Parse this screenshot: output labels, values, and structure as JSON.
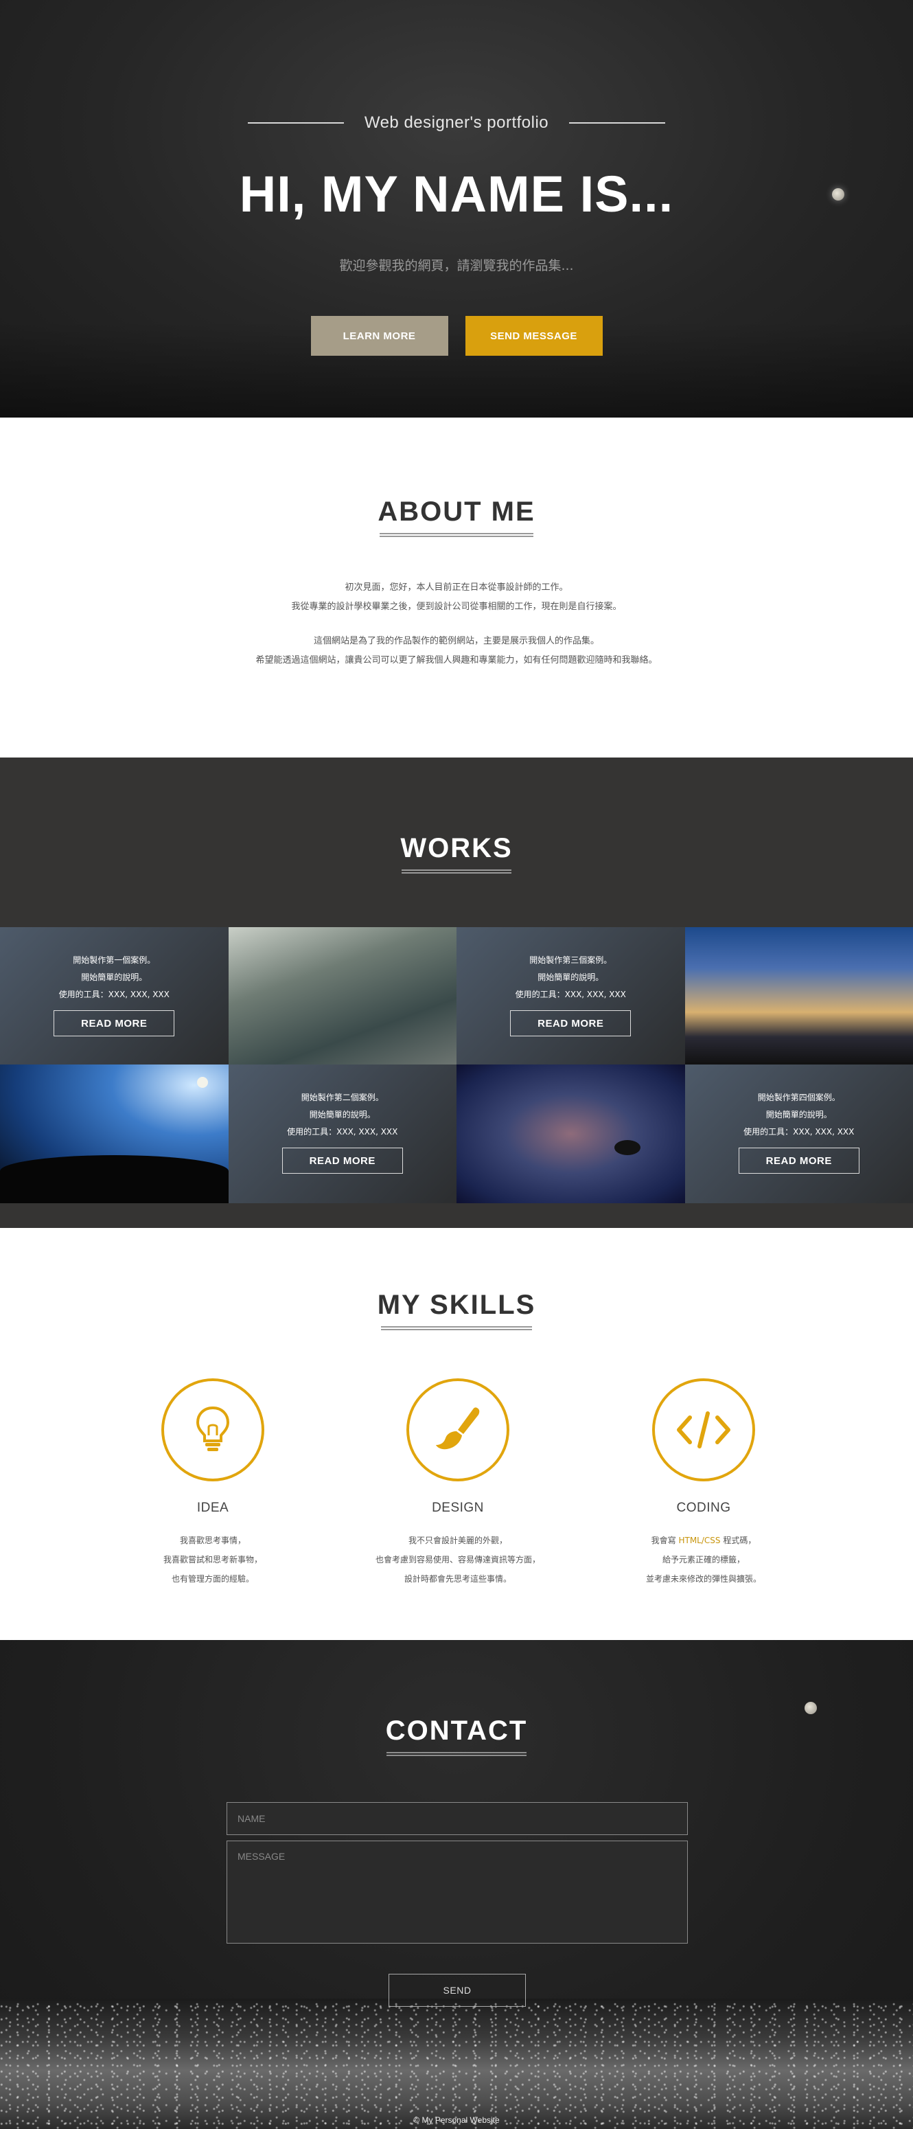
{
  "hero": {
    "subtitle": "Web designer's portfolio",
    "title": "HI, MY NAME IS...",
    "description": "歡迎參觀我的網頁，請瀏覽我的作品集...",
    "learn_more": "LEARN MORE",
    "send_message": "SEND MESSAGE",
    "colors": {
      "learn_more_bg": "#a69d88",
      "send_message_bg": "#d9a00e"
    }
  },
  "about": {
    "title": "ABOUT ME",
    "paragraph1": [
      "初次見面，您好，本人目前正在日本從事設計師的工作。",
      "我從專業的設計學校畢業之後，便到設計公司從事相關的工作，現在則是自行接案。"
    ],
    "paragraph2": [
      "這個網站是為了我的作品製作的範例網站，主要是展示我個人的作品集。",
      "希望能透過這個網站，讓貴公司可以更了解我個人興趣和專業能力，如有任何問題歡迎隨時和我聯絡。"
    ]
  },
  "works": {
    "title": "WORKS",
    "items": [
      {
        "lines": [
          "開始製作第一個案例。",
          "開始簡單的說明。",
          "使用的工具：XXX, XXX, XXX"
        ],
        "button": "READ MORE"
      },
      {
        "lines": [
          "開始製作第二個案例。",
          "開始簡單的說明。",
          "使用的工具：XXX, XXX, XXX"
        ],
        "button": "READ MORE"
      },
      {
        "lines": [
          "開始製作第三個案例。",
          "開始簡單的說明。",
          "使用的工具：XXX, XXX, XXX"
        ],
        "button": "READ MORE"
      },
      {
        "lines": [
          "開始製作第四個案例。",
          "開始簡單的說明。",
          "使用的工具：XXX, XXX, XXX"
        ],
        "button": "READ MORE"
      }
    ]
  },
  "skills": {
    "title": "MY SKILLS",
    "accent": "#e1a50d",
    "items": [
      {
        "icon": "lightbulb-icon",
        "name": "IDEA",
        "lines": [
          "我喜歡思考事情，",
          "我喜歡嘗試和思考新事物，",
          "也有管理方面的經驗。"
        ]
      },
      {
        "icon": "paintbrush-icon",
        "name": "DESIGN",
        "lines": [
          "我不只會設計美麗的外觀，",
          "也會考慮到容易使用、容易傳達資訊等方面，",
          "設計時都會先思考這些事情。"
        ]
      },
      {
        "icon": "code-icon",
        "name": "CODING",
        "lines_pre": "我會寫 ",
        "lines_hl": "HTML/CSS",
        "lines_post": " 程式碼，",
        "lines": [
          "給予元素正確的標籤，",
          "並考慮未來修改的彈性與擴張。"
        ]
      }
    ]
  },
  "contact": {
    "title": "CONTACT",
    "name_placeholder": "NAME",
    "message_placeholder": "MESSAGE",
    "send": "SEND",
    "footer": "© My Personal Website"
  }
}
